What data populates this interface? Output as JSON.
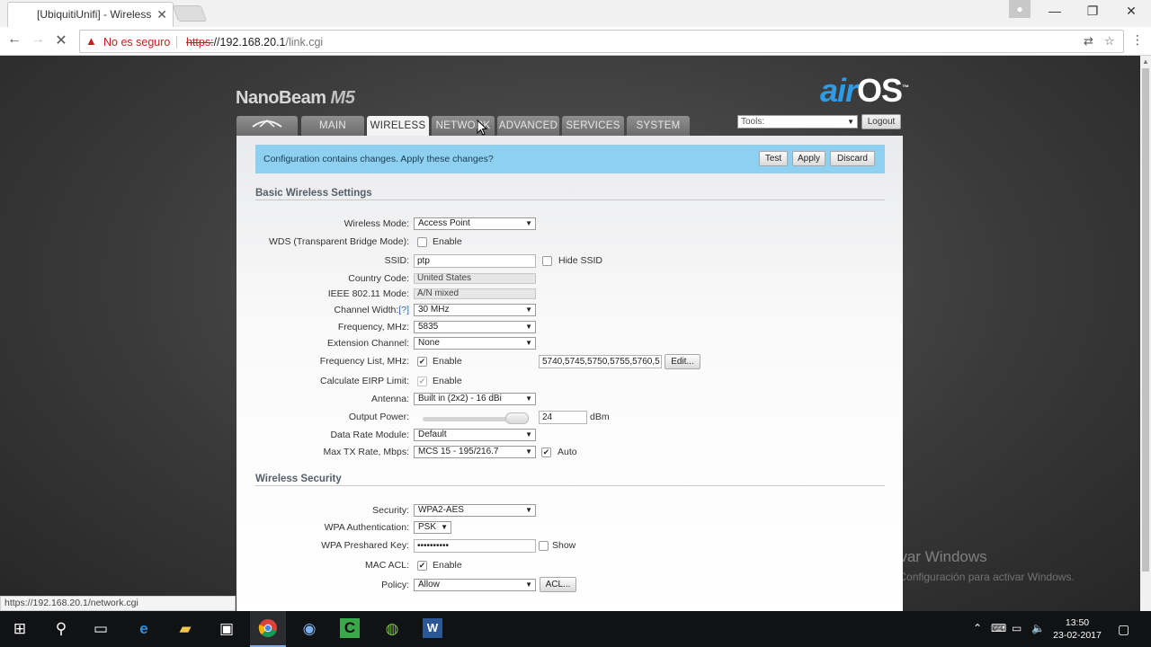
{
  "browser": {
    "tab_title": "[UbiquitiUnifi] - Wireless",
    "not_secure": "No es seguro",
    "url_scheme": "https:",
    "url_host": "//192.168.20.1",
    "url_path": "/link.cgi",
    "status_url": "https://192.168.20.1/network.cgi"
  },
  "header": {
    "product": "NanoBeam",
    "model": "M5",
    "os_air": "air",
    "os_name": "OS",
    "os_tm": "™",
    "tools_label": "Tools:",
    "logout_label": "Logout"
  },
  "nav": {
    "main": "MAIN",
    "wireless": "WIRELESS",
    "network": "NETWORK",
    "advanced": "ADVANCED",
    "services": "SERVICES",
    "system": "SYSTEM"
  },
  "banner": {
    "message": "Configuration contains changes. Apply these changes?",
    "test": "Test",
    "apply": "Apply",
    "discard": "Discard"
  },
  "basic": {
    "title": "Basic Wireless Settings",
    "wireless_mode_label": "Wireless Mode:",
    "wireless_mode_value": "Access Point",
    "wds_label": "WDS (Transparent Bridge Mode):",
    "enable": "Enable",
    "ssid_label": "SSID:",
    "ssid_value": "ptp",
    "hide_ssid": "Hide SSID",
    "country_label": "Country Code:",
    "country_value": "United States",
    "ieee_label": "IEEE 802.11 Mode:",
    "ieee_value": "A/N mixed",
    "channel_width_label": "Channel Width:",
    "help": "[?]",
    "channel_width_value": "30 MHz",
    "frequency_label": "Frequency, MHz:",
    "frequency_value": "5835",
    "extension_label": "Extension Channel:",
    "extension_value": "None",
    "freq_list_label": "Frequency List, MHz:",
    "freq_list_value": "5740,5745,5750,5755,5760,5",
    "edit": "Edit...",
    "eirp_label": "Calculate EIRP Limit:",
    "antenna_label": "Antenna:",
    "antenna_value": "Built in (2x2) - 16 dBi",
    "output_power_label": "Output Power:",
    "output_power_value": "24",
    "output_power_unit": "dBm",
    "data_rate_label": "Data Rate Module:",
    "data_rate_value": "Default",
    "max_tx_label": "Max TX Rate, Mbps:",
    "max_tx_value": "MCS 15 - 195/216.7",
    "auto": "Auto"
  },
  "security": {
    "title": "Wireless Security",
    "security_label": "Security:",
    "security_value": "WPA2-AES",
    "wpa_auth_label": "WPA Authentication:",
    "wpa_auth_value": "PSK",
    "wpa_key_label": "WPA Preshared Key:",
    "wpa_key_value": "••••••••••",
    "show": "Show",
    "mac_acl_label": "MAC ACL:",
    "policy_label": "Policy:",
    "policy_value": "Allow",
    "acl": "ACL..."
  },
  "watermark": {
    "line1": "Activar Windows",
    "line2": "Ve a Configuración para activar Windows."
  },
  "taskbar": {
    "time": "13:50",
    "date": "23-02-2017"
  }
}
